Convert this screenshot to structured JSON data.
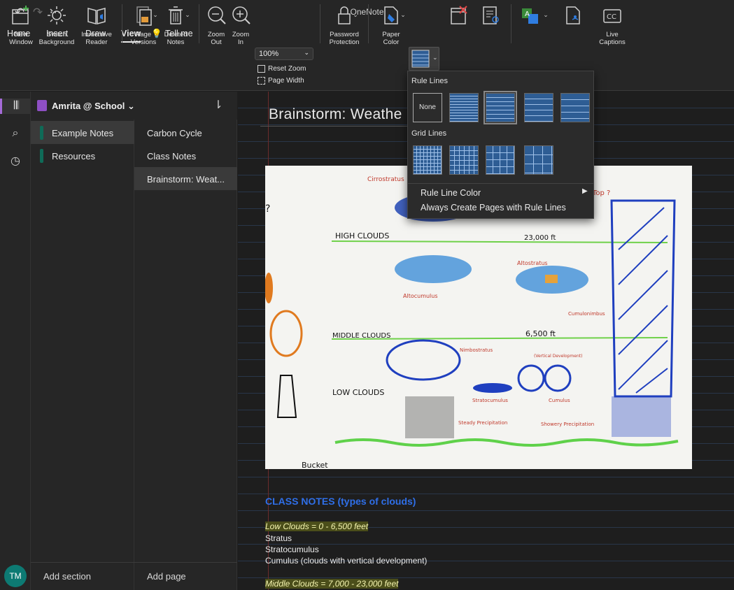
{
  "window": {
    "title": "OneNote"
  },
  "menu": {
    "tabs": [
      "Home",
      "Insert",
      "Draw",
      "View",
      "Tell me"
    ],
    "active": "View"
  },
  "ribbon": {
    "new_window": "New\nWindow",
    "switch_background": "Switch\nBackground",
    "immersive_reader": "Immersive\nReader",
    "page_versions": "Page\nVersions",
    "deleted_notes": "Deleted\nNotes",
    "zoom_out": "Zoom\nOut",
    "zoom_in": "Zoom\nIn",
    "zoom_level": "100%",
    "reset_zoom": "Reset Zoom",
    "page_width": "Page Width",
    "password_protection": "Password\nProtection",
    "paper_color": "Paper\nColor",
    "live_captions": "Live\nCaptions"
  },
  "notebook": {
    "name": "Amrita @ School"
  },
  "sections": [
    "Example Notes",
    "Resources"
  ],
  "add_section": "Add section",
  "pages": [
    "Carbon Cycle",
    "Class Notes",
    "Brainstorm: Weat..."
  ],
  "add_page": "Add page",
  "page": {
    "title": "Brainstorm: Weathe",
    "notes_heading": "CLASS NOTES (types of clouds)",
    "lines": [
      "Low Clouds = 0 - 6,500 feet",
      "Stratus",
      "Stratocumulus",
      "Cumulus (clouds with vertical development)",
      "Middle Clouds = 7,000 - 23,000 feet"
    ]
  },
  "photo": {
    "labels": {
      "cirrostratus": "Cirrostratus",
      "high_clouds": "HIGH CLOUDS",
      "ft_23000": "23,000 ft",
      "altostratus": "Altostratus",
      "altocumulus": "Altocumulus",
      "cumulonimbus": "Cumulonimbus",
      "middle_clouds": "MIDDLE CLOUDS",
      "ft_6500": "6,500 ft",
      "nimbostratus": "Nimbostratus",
      "vertical": "(Vertical Development)",
      "low_clouds": "LOW CLOUDS",
      "stratocumulus": "Stratocumulus",
      "cumulus": "Cumulus",
      "steady": "Steady Precipitation",
      "showery": "Showery Precipitation",
      "top": "Top ?",
      "left_q": "?",
      "bucket": "Bucket"
    }
  },
  "rule_menu": {
    "rule_lines_header": "Rule Lines",
    "none_label": "None",
    "grid_lines_header": "Grid Lines",
    "rule_line_color": "Rule Line Color",
    "always_create": "Always Create Pages with Rule Lines"
  },
  "user": {
    "initials": "TM"
  },
  "colors": {
    "accent": "#a56bd8",
    "rule_blue": "#2e5d94",
    "avatar": "#0d7a73",
    "notes_heading": "#2f6fe8"
  }
}
